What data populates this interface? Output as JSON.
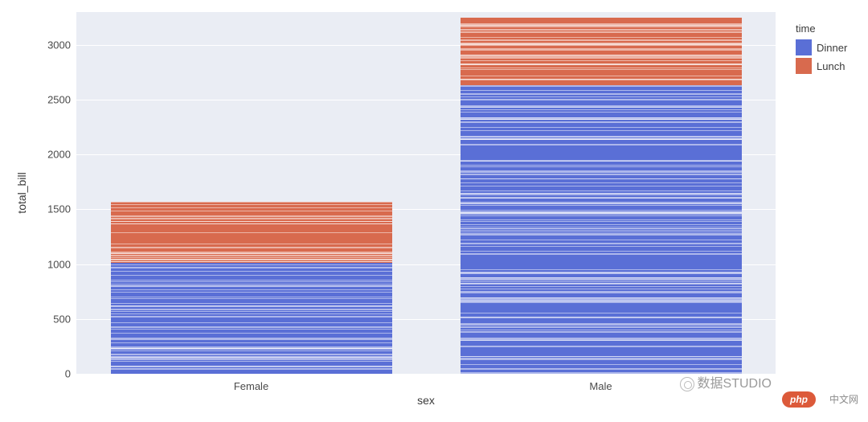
{
  "chart_data": {
    "type": "bar",
    "stacked": true,
    "categories": [
      "Female",
      "Male"
    ],
    "series": [
      {
        "name": "Dinner",
        "values": [
          1010,
          2630
        ],
        "color": "#5a6fd6"
      },
      {
        "name": "Lunch",
        "values": [
          560,
          620
        ],
        "color": "#d86a4e"
      }
    ],
    "xlabel": "sex",
    "ylabel": "total_bill",
    "ylim": [
      0,
      3300
    ],
    "yticks": [
      0,
      500,
      1000,
      1500,
      2000,
      2500,
      3000
    ],
    "legend_title": "time",
    "legend_position": "right",
    "grid": true
  },
  "legend": {
    "title": "time",
    "items": [
      {
        "label": "Dinner",
        "color": "#5a6fd6"
      },
      {
        "label": "Lunch",
        "color": "#d86a4e"
      }
    ]
  },
  "watermark": {
    "text": "数据STUDIO",
    "badge": "php",
    "badge_suffix": "中文网"
  }
}
